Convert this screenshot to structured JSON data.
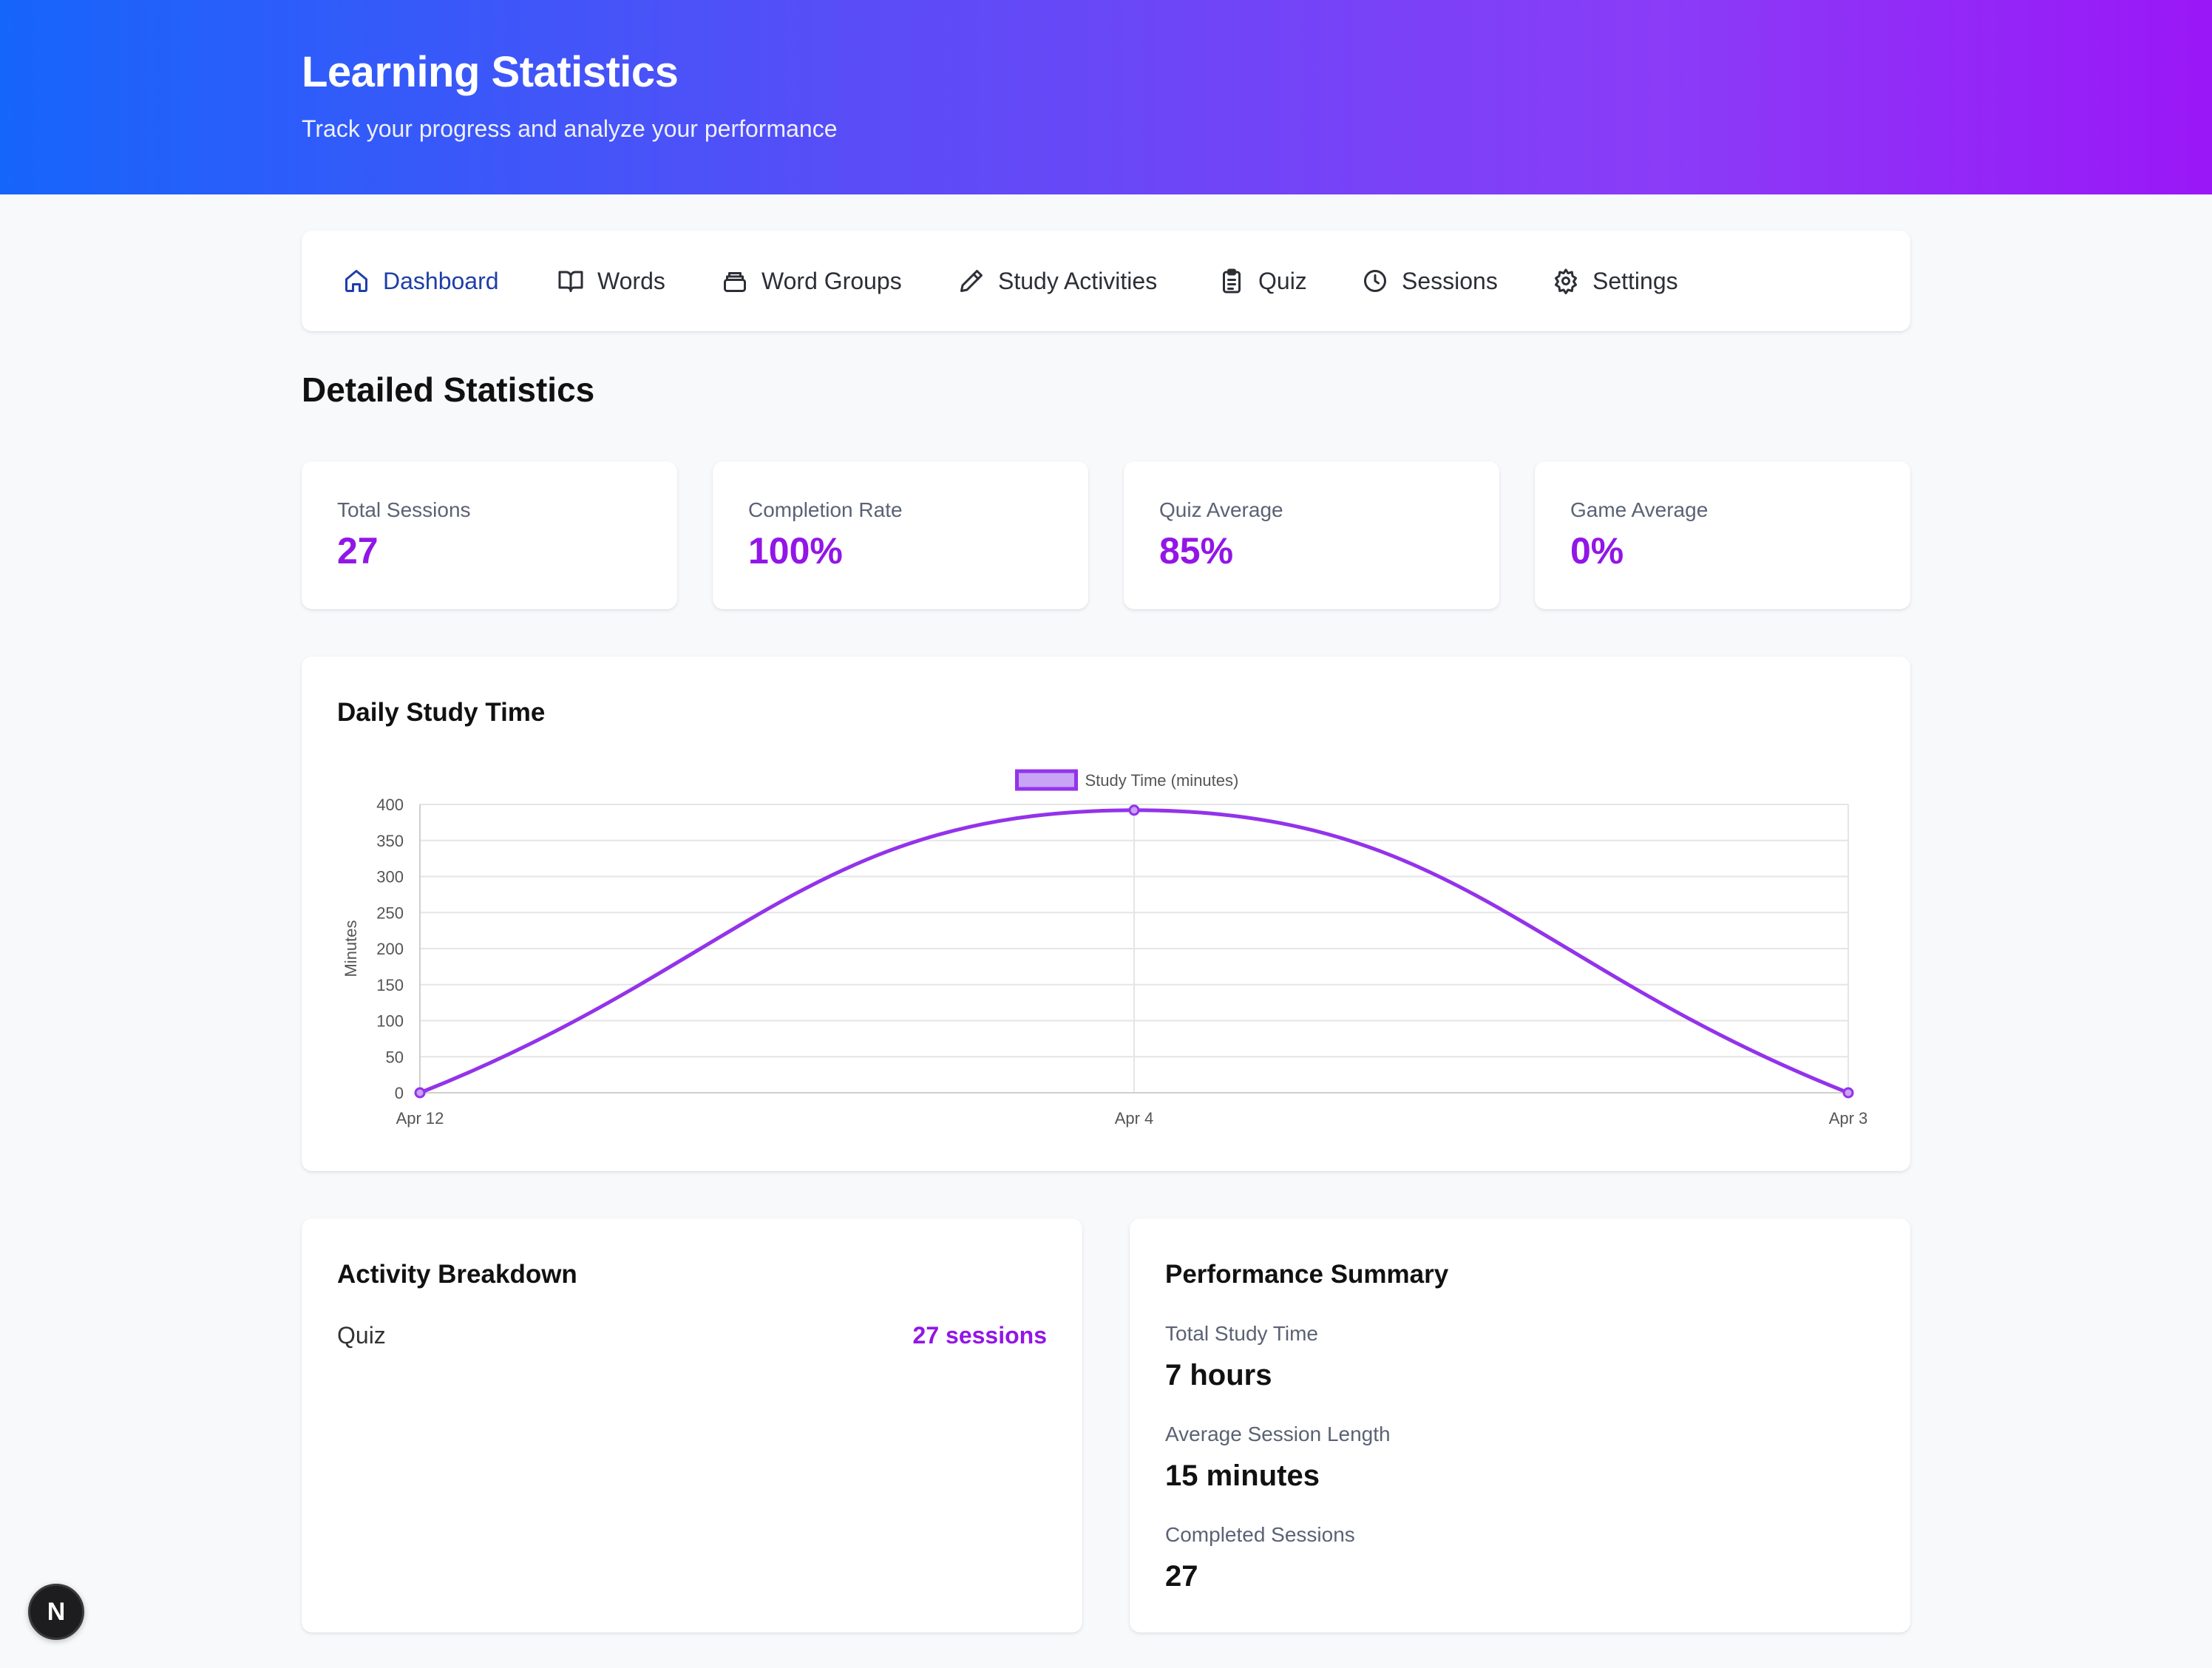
{
  "header": {
    "title": "Learning Statistics",
    "subtitle": "Track your progress and analyze your performance"
  },
  "nav": {
    "items": [
      {
        "label": "Dashboard",
        "icon": "home-icon",
        "active": true
      },
      {
        "label": "Words",
        "icon": "book-icon"
      },
      {
        "label": "Word Groups",
        "icon": "stack-icon"
      },
      {
        "label": "Study Activities",
        "icon": "pencil-icon"
      },
      {
        "label": "Quiz",
        "icon": "clipboard-icon"
      },
      {
        "label": "Sessions",
        "icon": "clock-icon"
      },
      {
        "label": "Settings",
        "icon": "gear-icon"
      }
    ]
  },
  "page_title": "Detailed Statistics",
  "stats": [
    {
      "label": "Total Sessions",
      "value": "27"
    },
    {
      "label": "Completion Rate",
      "value": "100%"
    },
    {
      "label": "Quiz Average",
      "value": "85%"
    },
    {
      "label": "Game Average",
      "value": "0%"
    }
  ],
  "chart_card": {
    "title": "Daily Study Time"
  },
  "chart_data": {
    "type": "line",
    "x": [
      "Apr 12",
      "Apr 4",
      "Apr 3"
    ],
    "series": [
      {
        "name": "Study Time (minutes)",
        "values": [
          0,
          392,
          0
        ]
      }
    ],
    "ylabel": "Minutes",
    "xlabel": "",
    "ylim": [
      0,
      400
    ],
    "yticks": [
      0,
      50,
      100,
      150,
      200,
      250,
      300,
      350,
      400
    ],
    "grid": true,
    "legend": "top-center",
    "color": "#9333ea"
  },
  "activity": {
    "title": "Activity Breakdown",
    "items": [
      {
        "label": "Quiz",
        "value": "27 sessions"
      }
    ]
  },
  "performance": {
    "title": "Performance Summary",
    "items": [
      {
        "label": "Total Study Time",
        "value": "7 hours"
      },
      {
        "label": "Average Session Length",
        "value": "15 minutes"
      },
      {
        "label": "Completed Sessions",
        "value": "27"
      }
    ]
  },
  "badge": {
    "letter": "N"
  },
  "colors": {
    "accent": "#9216e6",
    "nav_active": "#1d3fa8",
    "gradient_start": "#1665fb",
    "gradient_end": "#9a17f7"
  }
}
